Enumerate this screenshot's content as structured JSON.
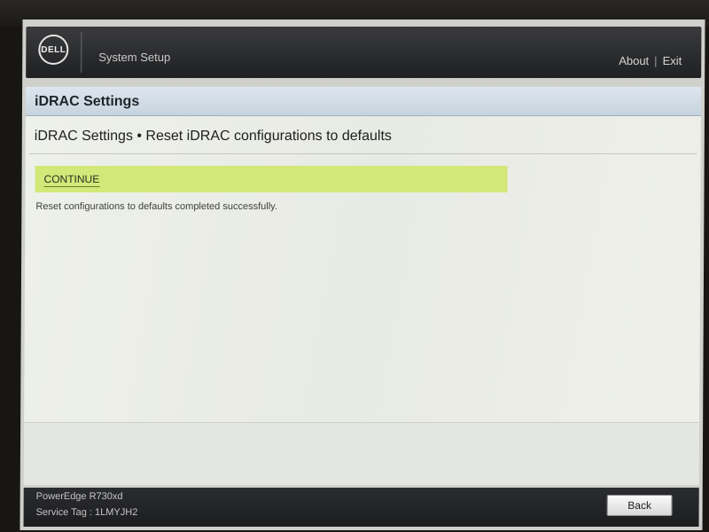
{
  "header": {
    "logo_text": "DELL",
    "app_title": "System Setup",
    "about_label": "About",
    "separator": "|",
    "exit_label": "Exit"
  },
  "section": {
    "title": "iDRAC Settings"
  },
  "content": {
    "breadcrumb": "iDRAC Settings • Reset iDRAC configurations to defaults",
    "continue_label": "CONTINUE",
    "status_message": "Reset configurations to defaults completed successfully."
  },
  "footer": {
    "model": "PowerEdge R730xd",
    "service_tag": "Service Tag : 1LMYJH2",
    "back_label": "Back"
  },
  "colors": {
    "highlight": "#d3e879",
    "header_bg": "#2b2c2e",
    "section_bar": "#c6d3de"
  },
  "icons": {
    "logo": "dell-logo-icon"
  }
}
